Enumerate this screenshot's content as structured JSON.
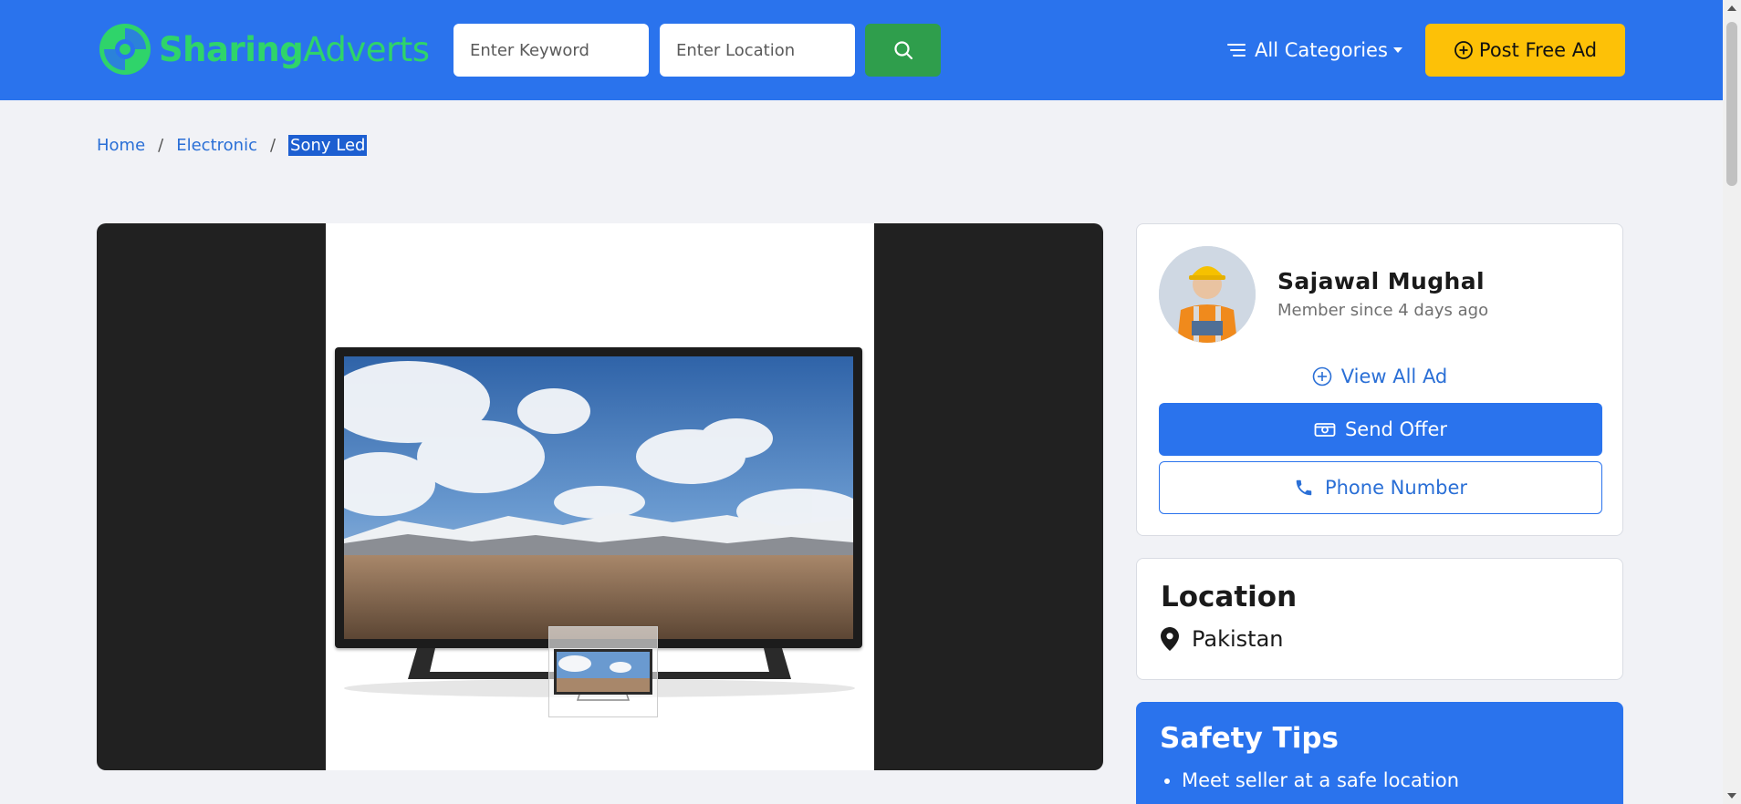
{
  "header": {
    "logo_part1": "Sharing",
    "logo_part2": "Adverts",
    "keyword_placeholder": "Enter Keyword",
    "location_placeholder": "Enter Location",
    "search_icon": "search-icon",
    "categories_label": "All Categories",
    "post_ad_label": "Post Free Ad",
    "colors": {
      "bar": "#2a73ed",
      "logo": "#2fd46a",
      "search_button": "#2f9e4c",
      "post_button": "#fdc107"
    }
  },
  "breadcrumb": {
    "items": [
      "Home",
      "Electronic"
    ],
    "separator": "/",
    "current": "Sony Led"
  },
  "seller": {
    "name": "Sajawal Mughal",
    "member_since": "Member since 4 days ago",
    "view_all_label": "View All Ad",
    "send_offer_label": "Send Offer",
    "phone_label": "Phone Number"
  },
  "location": {
    "title": "Location",
    "value": "Pakistan"
  },
  "safety": {
    "title": "Safety Tips",
    "tips": [
      "Meet seller at a safe location"
    ]
  }
}
